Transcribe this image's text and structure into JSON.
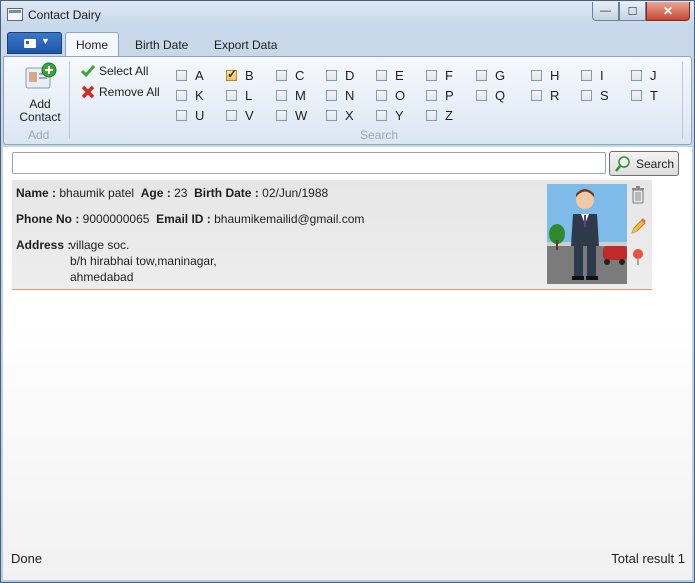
{
  "window": {
    "title": "Contact Dairy",
    "minimize": "—",
    "maximize": "☐",
    "close": "✕"
  },
  "ribbon": {
    "tabs": [
      "Home",
      "Birth Date",
      "Export Data"
    ],
    "add_group": {
      "button_label_line1": "Add",
      "button_label_line2": "Contact",
      "group_label": "Add"
    },
    "select_all": "Select All",
    "remove_all": "Remove All",
    "search_group_label": "Search",
    "letters": [
      {
        "l": "A",
        "checked": false
      },
      {
        "l": "B",
        "checked": true
      },
      {
        "l": "C",
        "checked": false
      },
      {
        "l": "D",
        "checked": false
      },
      {
        "l": "E",
        "checked": false
      },
      {
        "l": "F",
        "checked": false
      },
      {
        "l": "G",
        "checked": false
      },
      {
        "l": "H",
        "checked": false
      },
      {
        "l": "I",
        "checked": false
      },
      {
        "l": "J",
        "checked": false
      },
      {
        "l": "K",
        "checked": false
      },
      {
        "l": "L",
        "checked": false
      },
      {
        "l": "M",
        "checked": false
      },
      {
        "l": "N",
        "checked": false
      },
      {
        "l": "O",
        "checked": false
      },
      {
        "l": "P",
        "checked": false
      },
      {
        "l": "Q",
        "checked": false
      },
      {
        "l": "R",
        "checked": false
      },
      {
        "l": "S",
        "checked": false
      },
      {
        "l": "T",
        "checked": false
      },
      {
        "l": "U",
        "checked": false
      },
      {
        "l": "V",
        "checked": false
      },
      {
        "l": "W",
        "checked": false
      },
      {
        "l": "X",
        "checked": false
      },
      {
        "l": "Y",
        "checked": false
      },
      {
        "l": "Z",
        "checked": false
      }
    ]
  },
  "search": {
    "value": "",
    "button": "Search"
  },
  "contact": {
    "name_label": "Name :",
    "name": "bhaumik patel",
    "age_label": "Age :",
    "age": "23",
    "birth_label": "Birth Date :",
    "birth": "02/Jun/1988",
    "phone_label": "Phone No :",
    "phone": "9000000065",
    "email_label": "Email ID :",
    "email": "bhaumikemailid@gmail.com",
    "address_label": "Address :",
    "address_lines": [
      "village soc.",
      "b/h hirabhai tow,maninagar,",
      "ahmedabad"
    ]
  },
  "status": {
    "left": "Done",
    "right": "Total result 1"
  },
  "colors": {
    "accent": "#1d56a8",
    "separator": "#e89a6a"
  }
}
